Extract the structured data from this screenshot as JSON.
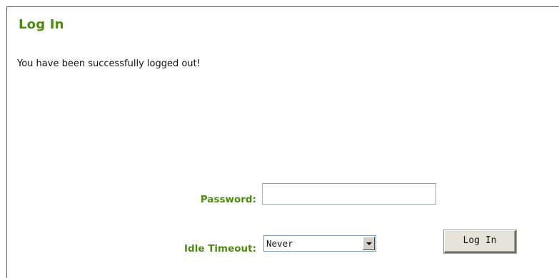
{
  "page": {
    "title": "Log In",
    "message": "You have been successfully logged out!"
  },
  "form": {
    "password_label": "Password:",
    "password_value": "",
    "idle_timeout_label": "Idle Timeout:",
    "idle_timeout_selected": "Never",
    "login_button_label": "Log In"
  },
  "colors": {
    "accent": "#4f8a10",
    "text": "#111111",
    "button_bg": "#e6e3d8"
  },
  "icons": {
    "select_arrow": "chevron-down-icon"
  }
}
